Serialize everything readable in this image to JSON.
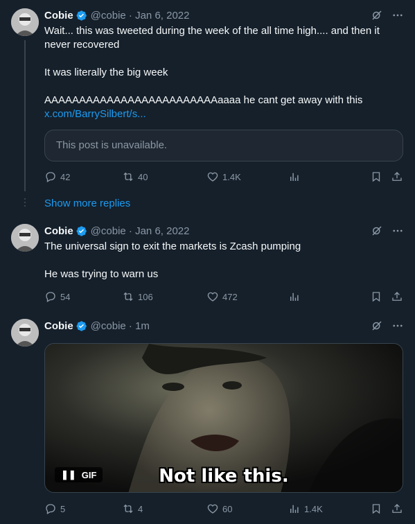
{
  "posts": [
    {
      "name": "Cobie",
      "meta": "@cobie · Jan 6, 2022",
      "lines": [
        "Wait... this was tweeted during the week of the all time high.... and then it never recovered",
        "It was literally the big week",
        "AAAAAAAAAAAAAAAAAAAAAAAAAaaaa he cant get away with this"
      ],
      "link": "x.com/BarrySilbert/s...",
      "quote_text": "This post is unavailable.",
      "replies": "42",
      "reposts": "40",
      "likes": "1.4K",
      "views": ""
    },
    {
      "name": "Cobie",
      "meta": "@cobie · Jan 6, 2022",
      "lines": [
        "The universal sign to exit the markets is Zcash pumping",
        "He was trying to warn us"
      ],
      "replies": "54",
      "reposts": "106",
      "likes": "472",
      "views": ""
    },
    {
      "name": "Cobie",
      "meta": "@cobie · 1m",
      "gif_label": "GIF",
      "gif_caption": "Not like this.",
      "replies": "5",
      "reposts": "4",
      "likes": "60",
      "views": "1.4K"
    }
  ],
  "show_more": "Show more replies",
  "colors": {
    "background": "#15202b",
    "text": "#f7f9f9",
    "muted": "#8b98a5",
    "link": "#1d9bf0",
    "border": "#38444d"
  }
}
